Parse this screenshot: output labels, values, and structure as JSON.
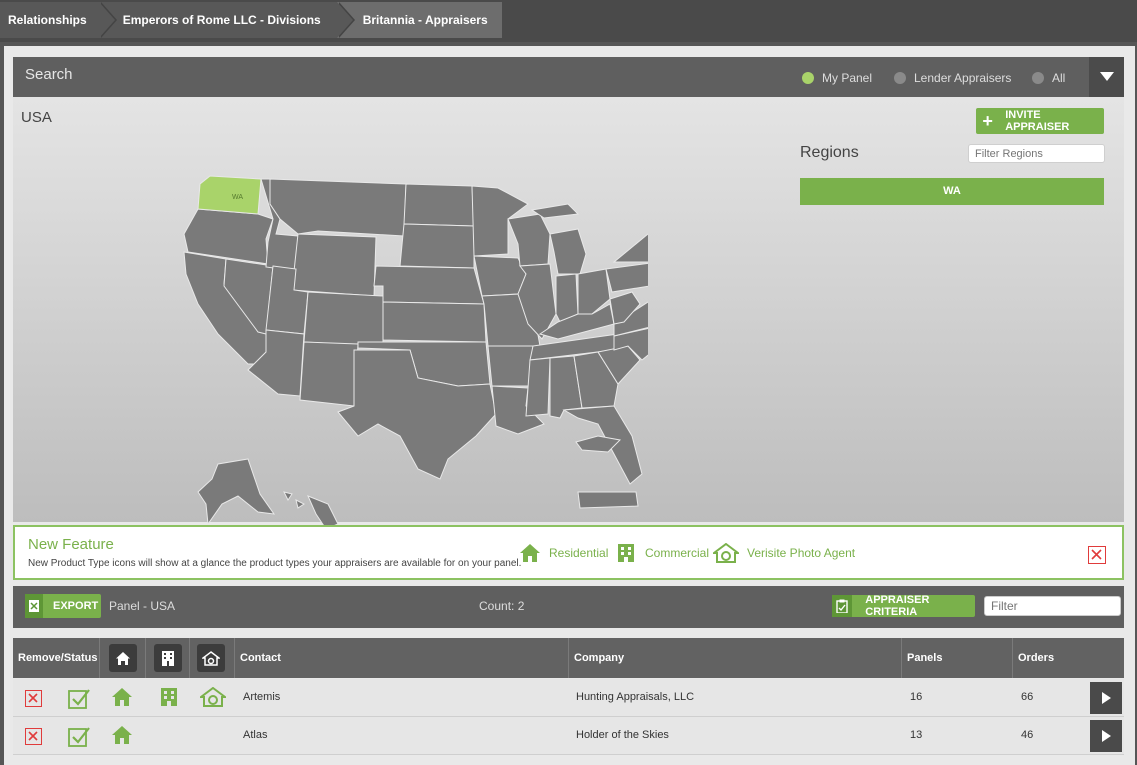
{
  "breadcrumbs": [
    "Relationships",
    "Emperors of Rome LLC - Divisions",
    "Britannia - Appraisers"
  ],
  "search": {
    "title": "Search",
    "filters": [
      {
        "label": "My Panel",
        "selected": true
      },
      {
        "label": "Lender Appraisers",
        "selected": false
      },
      {
        "label": "All",
        "selected": false
      }
    ]
  },
  "map": {
    "country_label": "USA",
    "selected_state": "WA",
    "invite_label": "INVITE APPRAISER",
    "regions_title": "Regions",
    "filter_regions_placeholder": "Filter Regions",
    "region_items": [
      "WA"
    ]
  },
  "feature": {
    "title": "New Feature",
    "description": "New Product Type icons will show at a glance the product types your appraisers are available for on your panel.",
    "types": [
      "Residential",
      "Commercial",
      "Verisite Photo Agent"
    ]
  },
  "toolbar": {
    "export_label": "EXPORT",
    "panel_label": "Panel - USA",
    "count_label": "Count: 2",
    "criteria_label": "APPRAISER CRITERIA",
    "filter_placeholder": "Filter"
  },
  "table": {
    "headers": {
      "remove_status": "Remove/Status",
      "contact": "Contact",
      "company": "Company",
      "panels": "Panels",
      "orders": "Orders"
    },
    "rows": [
      {
        "contact": "Artemis",
        "company": "Hunting Appraisals, LLC",
        "panels": "16",
        "orders": "66",
        "residential": true,
        "commercial": true,
        "photo": true
      },
      {
        "contact": "Atlas",
        "company": "Holder of the Skies",
        "panels": "13",
        "orders": "46",
        "residential": true,
        "commercial": false,
        "photo": false
      }
    ]
  },
  "colors": {
    "accent": "#7ab14b",
    "dark": "#5f5f5f",
    "danger": "#e03b3b",
    "state_gray": "#7a7a7a",
    "state_selected": "#a9d36a"
  }
}
